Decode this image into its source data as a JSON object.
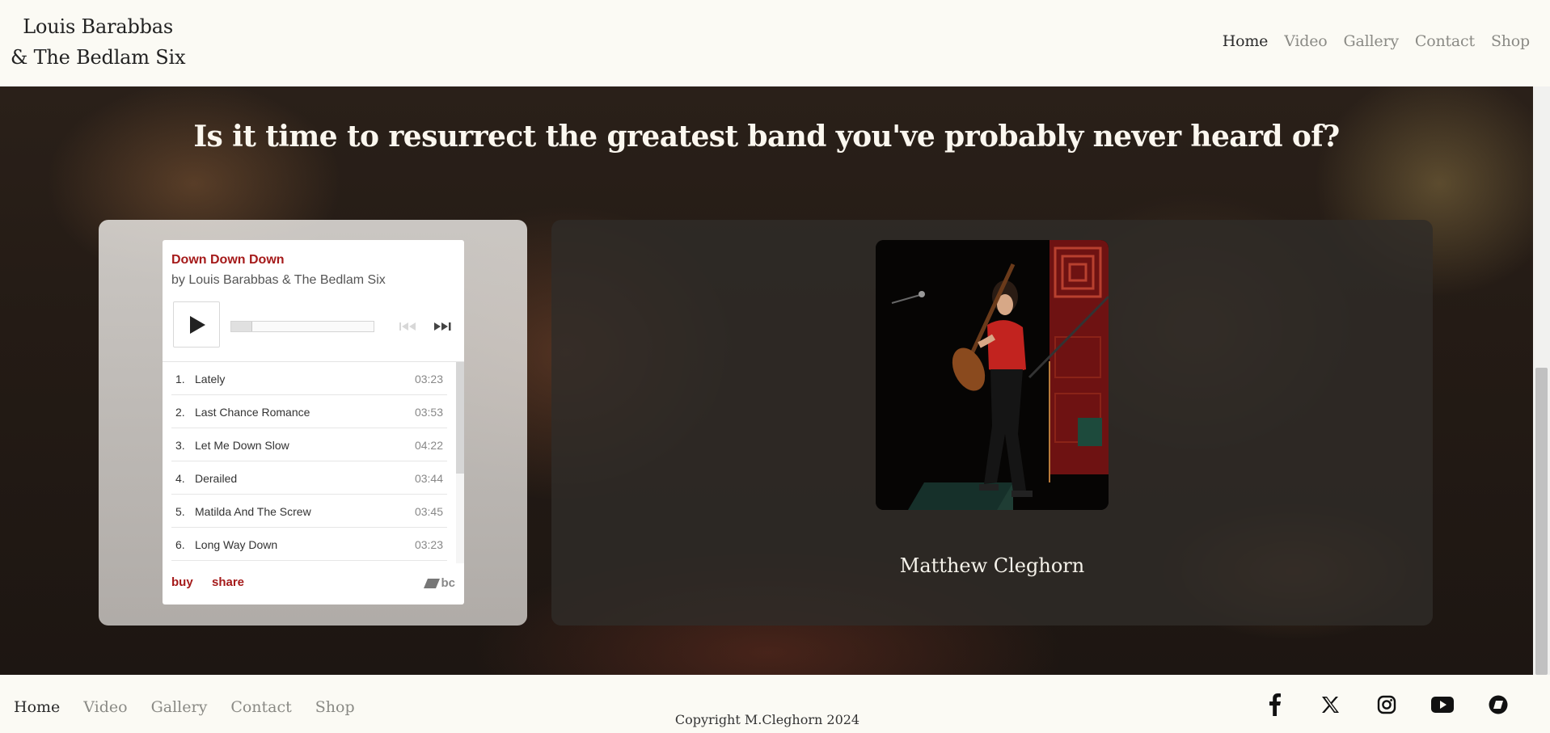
{
  "header": {
    "logo_line1": "Louis Barabbas",
    "logo_line2": "& The Bedlam Six",
    "nav": [
      {
        "label": "Home",
        "active": true
      },
      {
        "label": "Video",
        "active": false
      },
      {
        "label": "Gallery",
        "active": false
      },
      {
        "label": "Contact",
        "active": false
      },
      {
        "label": "Shop",
        "active": false
      }
    ]
  },
  "hero": {
    "title": "Is it time to resurrect the greatest band you've probably never heard of?"
  },
  "player": {
    "album": "Down Down Down",
    "artist": "by Louis Barabbas & The Bedlam Six",
    "progress": 0.15,
    "tracks": [
      {
        "num": "1.",
        "name": "Lately",
        "duration": "03:23"
      },
      {
        "num": "2.",
        "name": "Last Chance Romance",
        "duration": "03:53"
      },
      {
        "num": "3.",
        "name": "Let Me Down Slow",
        "duration": "04:22"
      },
      {
        "num": "4.",
        "name": "Derailed",
        "duration": "03:44"
      },
      {
        "num": "5.",
        "name": "Matilda And The Screw",
        "duration": "03:45"
      },
      {
        "num": "6.",
        "name": "Long Way Down",
        "duration": "03:23"
      }
    ],
    "buy_label": "buy",
    "share_label": "share",
    "brand": "bc",
    "accent_color": "#a51a1a"
  },
  "photo": {
    "caption": "Matthew Cleghorn"
  },
  "footer": {
    "nav": [
      {
        "label": "Home",
        "active": true
      },
      {
        "label": "Video",
        "active": false
      },
      {
        "label": "Gallery",
        "active": false
      },
      {
        "label": "Contact",
        "active": false
      },
      {
        "label": "Shop",
        "active": false
      }
    ],
    "copyright": "Copyright M.Cleghorn 2024",
    "socials": [
      "facebook-icon",
      "x-icon",
      "instagram-icon",
      "youtube-icon",
      "bandcamp-icon"
    ]
  }
}
